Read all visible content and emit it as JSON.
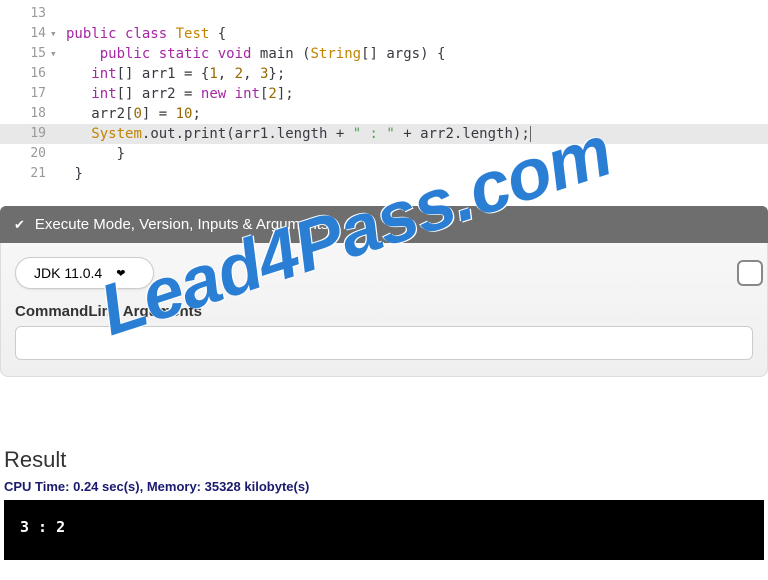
{
  "code": {
    "lines": [
      {
        "n": "13",
        "fold": "",
        "text": ""
      },
      {
        "n": "14",
        "fold": "▾",
        "text": "public class Test {"
      },
      {
        "n": "15",
        "fold": "▾",
        "text": "    public static void main (String[] args) {"
      },
      {
        "n": "16",
        "fold": "",
        "text": "   int[] arr1 = {1, 2, 3};"
      },
      {
        "n": "17",
        "fold": "",
        "text": "   int[] arr2 = new int[2];"
      },
      {
        "n": "18",
        "fold": "",
        "text": "   arr2[0] = 10;"
      },
      {
        "n": "19",
        "fold": "",
        "text": "   System.out.print(arr1.length + \" : \" + arr2.length);"
      },
      {
        "n": "20",
        "fold": "",
        "text": "      }"
      },
      {
        "n": "21",
        "fold": "",
        "text": " }"
      }
    ],
    "highlighted_line": "19"
  },
  "exec": {
    "header": "Execute Mode, Version, Inputs & Arguments",
    "jdk": "JDK 11.0.4",
    "cmdline_label": "CommandLine Arguments",
    "cmdline_value": ""
  },
  "result": {
    "title": "Result",
    "cpu": "CPU Time: 0.24 sec(s), Memory: 35328 kilobyte(s)",
    "output": "3 : 2"
  },
  "watermark": "Lead4Pass.com"
}
